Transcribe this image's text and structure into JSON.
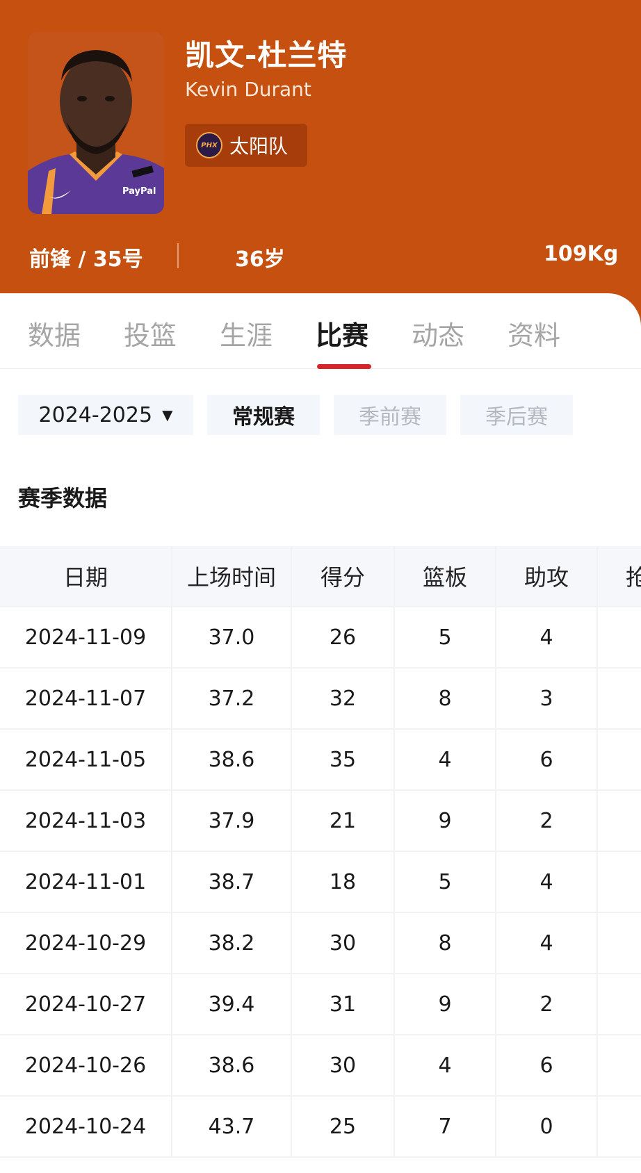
{
  "player": {
    "name_cn": "凯文-杜兰特",
    "name_en": "Kevin Durant",
    "team": "太阳队",
    "team_logo_text": "PHX",
    "position_number": "前锋 / 35号",
    "age": "36岁",
    "weight": "109Kg",
    "jersey_sponsor": "PayPal"
  },
  "colors": {
    "header_bg": "#c5500f",
    "tab_accent": "#d6242b",
    "jersey_purple": "#5a3a96"
  },
  "tabs": [
    {
      "label": "数据"
    },
    {
      "label": "投篮"
    },
    {
      "label": "生涯"
    },
    {
      "label": "比赛",
      "active": true
    },
    {
      "label": "动态"
    },
    {
      "label": "资料"
    }
  ],
  "filters": {
    "season": "2024-2025",
    "caret": "▼",
    "types": [
      {
        "label": "常规赛",
        "active": true
      },
      {
        "label": "季前赛"
      },
      {
        "label": "季后赛"
      }
    ]
  },
  "section_title": "赛季数据",
  "table": {
    "headers": [
      "日期",
      "上场时间",
      "得分",
      "篮板",
      "助攻",
      "抢"
    ],
    "rows": [
      [
        "2024-11-09",
        "37.0",
        "26",
        "5",
        "4"
      ],
      [
        "2024-11-07",
        "37.2",
        "32",
        "8",
        "3"
      ],
      [
        "2024-11-05",
        "38.6",
        "35",
        "4",
        "6"
      ],
      [
        "2024-11-03",
        "37.9",
        "21",
        "9",
        "2"
      ],
      [
        "2024-11-01",
        "38.7",
        "18",
        "5",
        "4"
      ],
      [
        "2024-10-29",
        "38.2",
        "30",
        "8",
        "4"
      ],
      [
        "2024-10-27",
        "39.4",
        "31",
        "9",
        "2"
      ],
      [
        "2024-10-26",
        "38.6",
        "30",
        "4",
        "6"
      ],
      [
        "2024-10-24",
        "43.7",
        "25",
        "7",
        "0"
      ]
    ]
  }
}
